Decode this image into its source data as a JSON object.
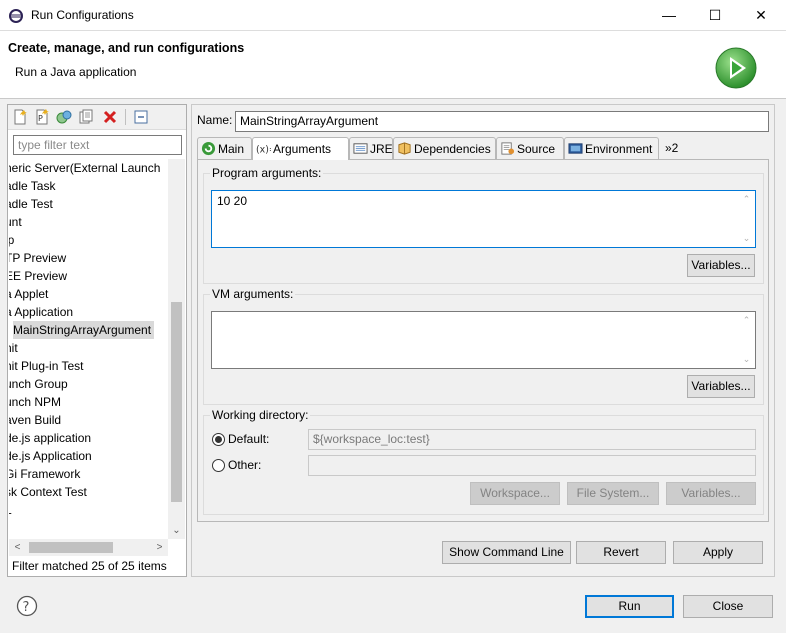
{
  "window": {
    "title": "Run Configurations"
  },
  "banner": {
    "title": "Create, manage, and run configurations",
    "subtitle": "Run a Java application"
  },
  "left": {
    "filter_placeholder": "type filter text",
    "items": [
      {
        "label": "neric Server(External Launch"
      },
      {
        "label": "adle Task"
      },
      {
        "label": "adle Test"
      },
      {
        "label": "unt"
      },
      {
        "label": "lp"
      },
      {
        "label": "TP Preview"
      },
      {
        "label": "EE Preview"
      },
      {
        "label": "a Applet"
      },
      {
        "label": "a Application"
      },
      {
        "label": "MainStringArrayArgument"
      },
      {
        "label": "nit"
      },
      {
        "label": "nit Plug-in Test"
      },
      {
        "label": "unch Group"
      },
      {
        "label": "unch NPM"
      },
      {
        "label": "aven Build"
      },
      {
        "label": "de.js application"
      },
      {
        "label": "de.js Application"
      },
      {
        "label": "Gi Framework"
      },
      {
        "label": "sk Context Test"
      },
      {
        "label": "L"
      }
    ],
    "status": "Filter matched 25 of 25 items"
  },
  "config": {
    "name_label": "Name:",
    "name_value": "MainStringArrayArgument",
    "tabs": [
      {
        "label": "Main",
        "icon": "main-tab-icon"
      },
      {
        "label": "Arguments",
        "icon": "arguments-tab-icon"
      },
      {
        "label": "JRE",
        "icon": "jre-tab-icon"
      },
      {
        "label": "Dependencies",
        "icon": "dependencies-tab-icon"
      },
      {
        "label": "Source",
        "icon": "source-tab-icon"
      },
      {
        "label": "Environment",
        "icon": "environment-tab-icon"
      }
    ],
    "tab_overflow": "»2",
    "program_args_label": "Program arguments:",
    "program_args_value": "10 20",
    "variables_label": "Variables...",
    "vm_args_label": "VM arguments:",
    "vm_args_value": "",
    "workdir_label": "Working directory:",
    "default_label": "Default:",
    "default_value": "${workspace_loc:test}",
    "other_label": "Other:",
    "other_value": "",
    "workspace_btn": "Workspace...",
    "filesystem_btn": "File System...",
    "show_cmd": "Show Command Line",
    "revert": "Revert",
    "apply": "Apply"
  },
  "footer": {
    "run": "Run",
    "close": "Close"
  },
  "colors": {
    "accent": "#0078d7",
    "run_green": "#3aa53a"
  }
}
